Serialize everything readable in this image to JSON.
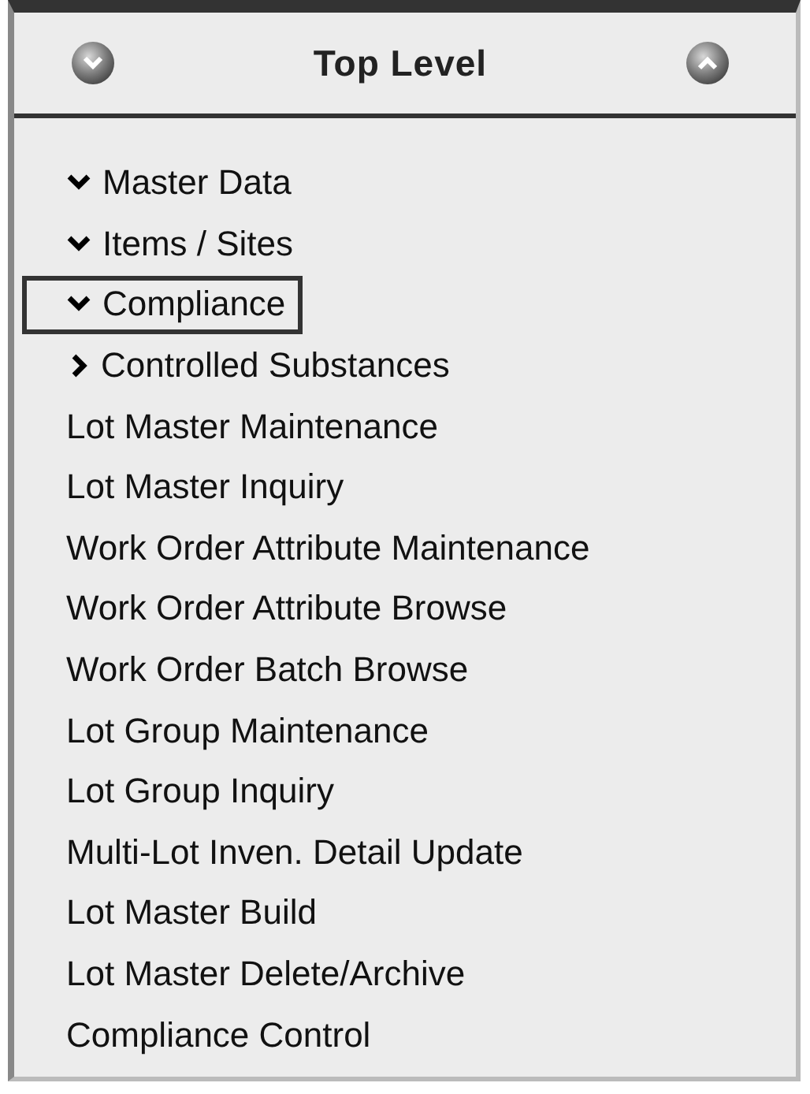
{
  "header": {
    "title": "Top Level",
    "buttons": [
      {
        "kind": "down"
      },
      {
        "kind": "up"
      }
    ]
  },
  "menu": [
    {
      "label": "Master Data",
      "kind": "expanded",
      "selected": false
    },
    {
      "label": "Items / Sites",
      "kind": "expanded",
      "selected": false
    },
    {
      "label": "Compliance",
      "kind": "expanded",
      "selected": true
    },
    {
      "label": "Controlled Substances",
      "kind": "collapsed",
      "selected": false
    },
    {
      "label": "Lot Master Maintenance",
      "kind": "leaf",
      "selected": false
    },
    {
      "label": "Lot Master Inquiry",
      "kind": "leaf",
      "selected": false
    },
    {
      "label": "Work Order Attribute Maintenance",
      "kind": "leaf",
      "selected": false
    },
    {
      "label": "Work Order Attribute Browse",
      "kind": "leaf",
      "selected": false
    },
    {
      "label": "Work Order Batch Browse",
      "kind": "leaf",
      "selected": false
    },
    {
      "label": "Lot Group Maintenance",
      "kind": "leaf",
      "selected": false
    },
    {
      "label": "Lot Group Inquiry",
      "kind": "leaf",
      "selected": false
    },
    {
      "label": "Multi-Lot Inven. Detail Update",
      "kind": "leaf",
      "selected": false
    },
    {
      "label": "Lot Master Build",
      "kind": "leaf",
      "selected": false
    },
    {
      "label": "Lot Master Delete/Archive",
      "kind": "leaf",
      "selected": false
    },
    {
      "label": "Compliance Control",
      "kind": "leaf",
      "selected": false
    }
  ]
}
